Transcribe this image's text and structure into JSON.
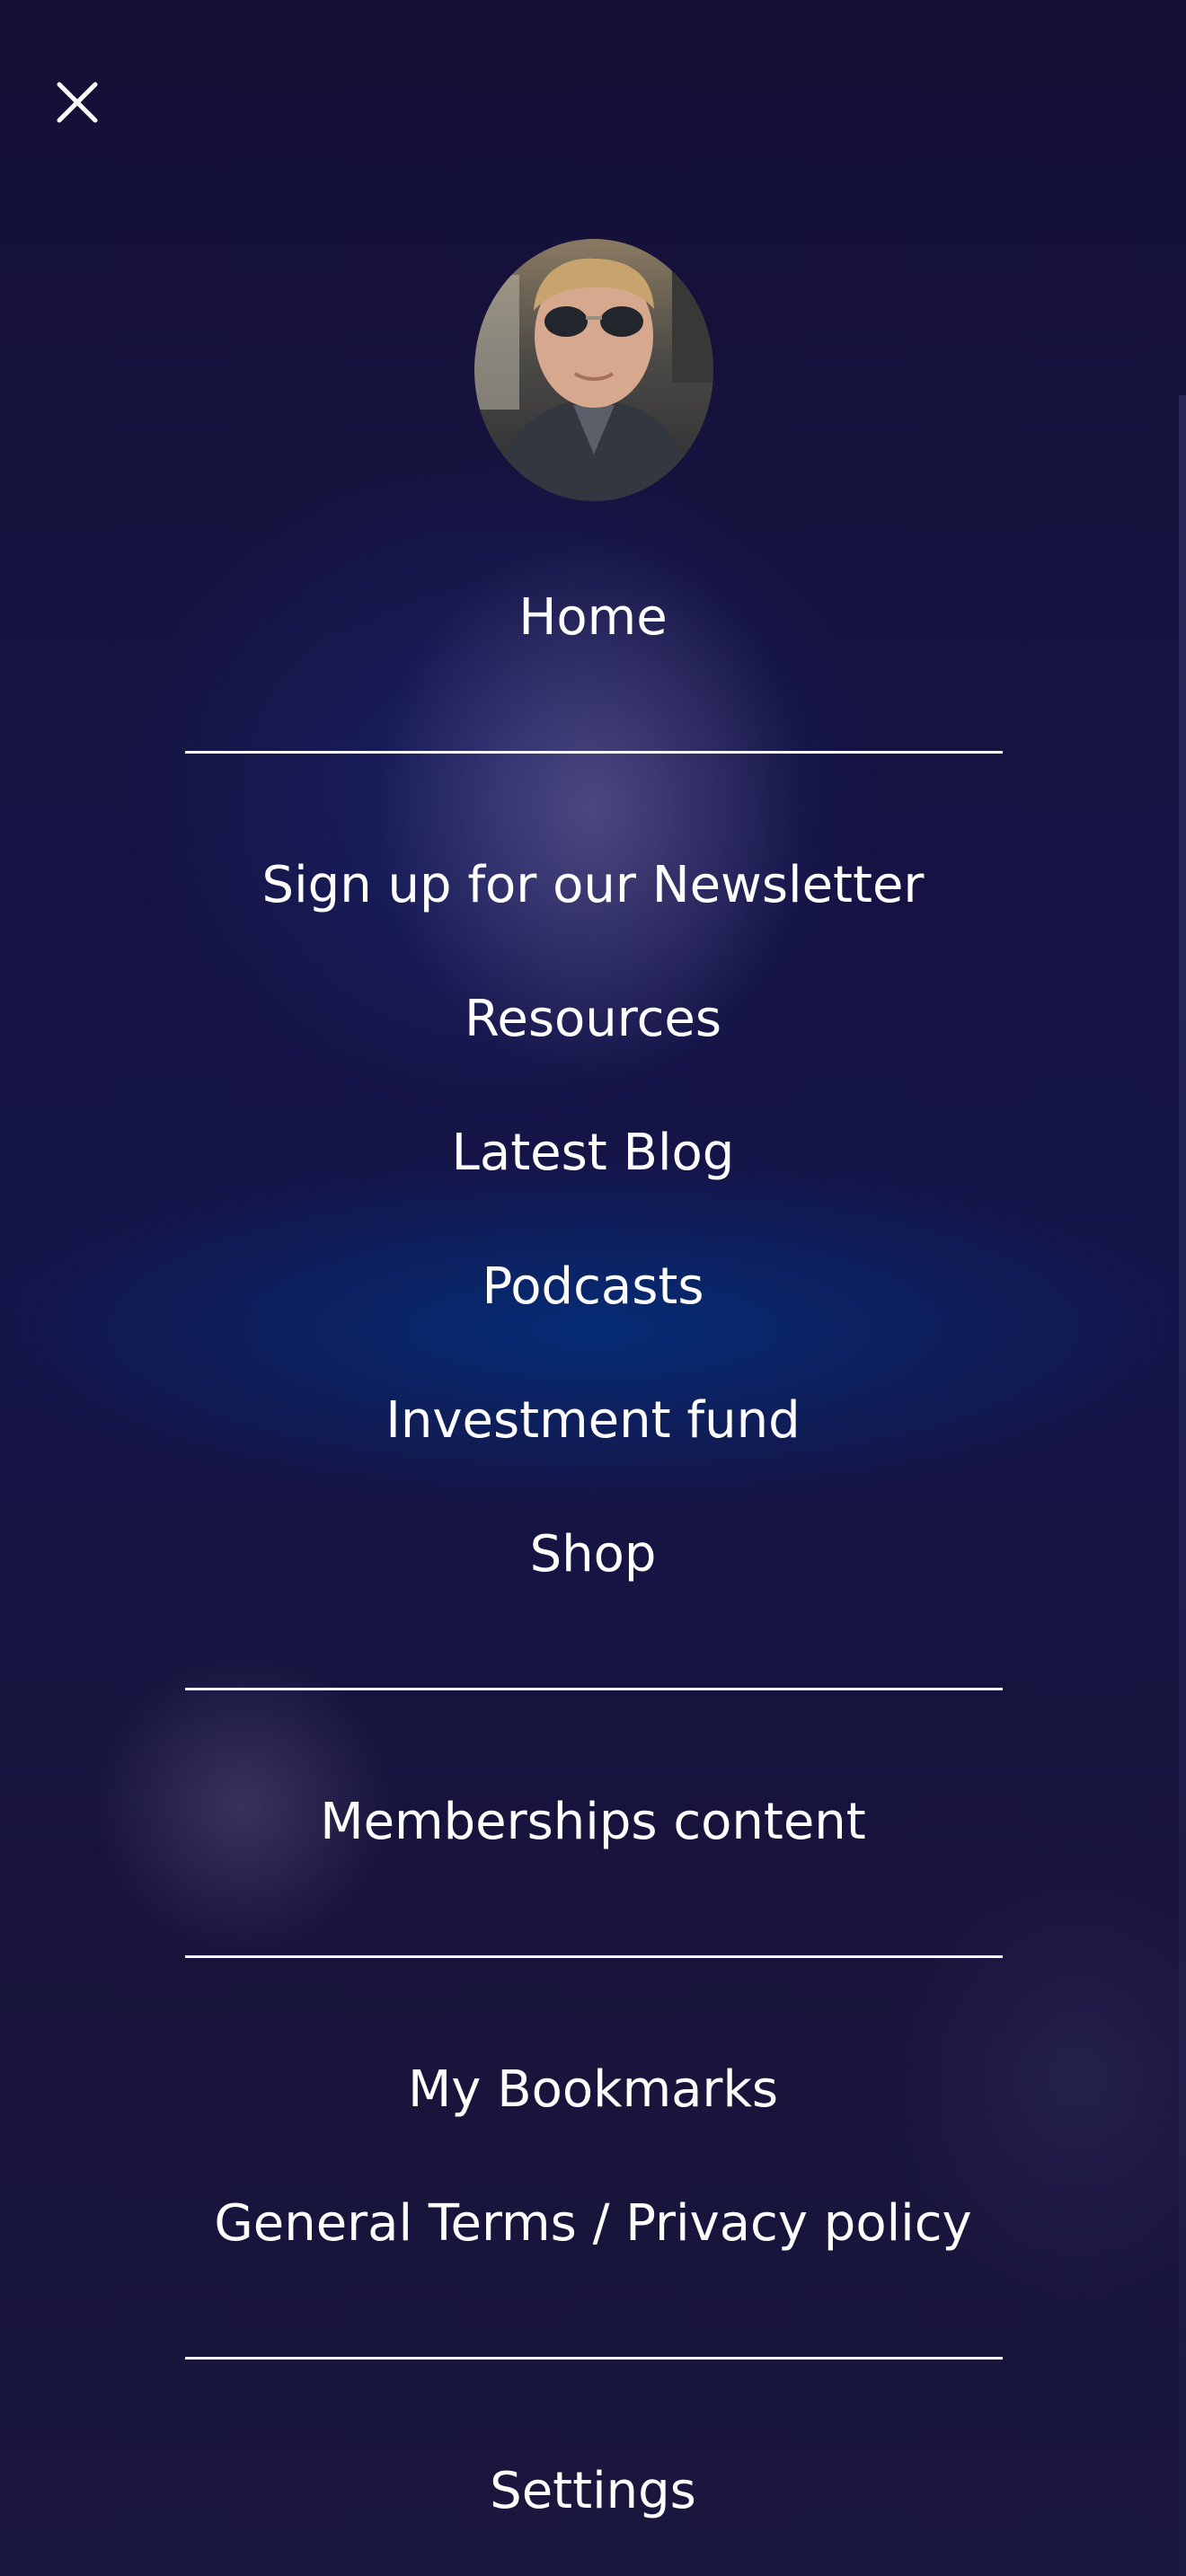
{
  "header": {
    "close_icon": "close-icon"
  },
  "profile": {
    "avatar_icon": "profile-photo"
  },
  "menu": {
    "home": "Home",
    "newsletter": "Sign up for our Newsletter",
    "resources": "Resources",
    "latest_blog": "Latest Blog",
    "podcasts": "Podcasts",
    "investment_fund": "Investment fund",
    "shop": "Shop",
    "memberships": "Memberships content",
    "bookmarks": "My Bookmarks",
    "terms": "General Terms / Privacy policy",
    "settings": "Settings"
  },
  "colors": {
    "background": "#161238",
    "glow_blue": "#052d78",
    "text": "#ffffff",
    "divider": "#f2f2f7"
  }
}
